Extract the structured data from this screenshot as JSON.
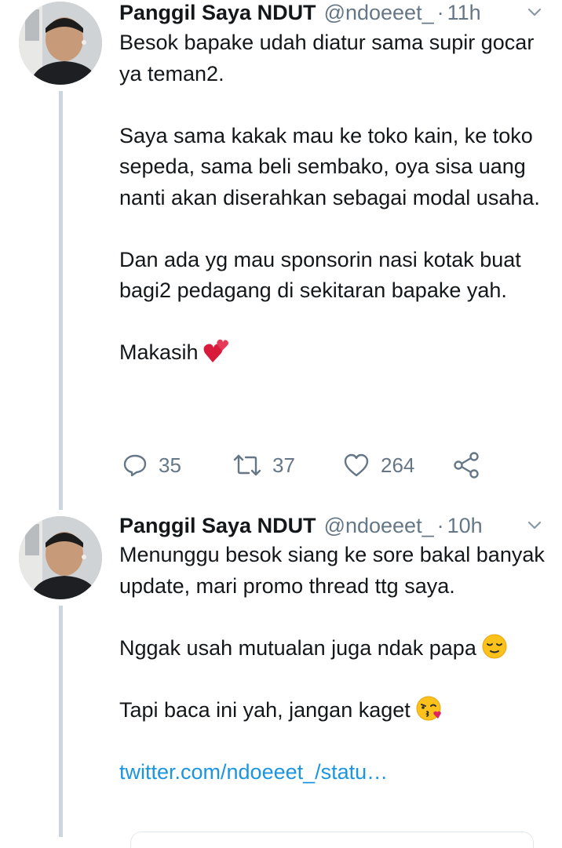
{
  "tweets": [
    {
      "author_name": "Panggil Saya NDUT",
      "handle": "@ndoeeet_",
      "separator": "·",
      "time": "11h",
      "paragraphs": [
        "Besok bapake udah diatur sama supir gocar ya teman2.",
        "Saya sama kakak mau ke toko kain, ke toko sepeda, sama beli sembako, oya sisa uang nanti akan diserahkan sebagai modal usaha.",
        "Dan ada yg mau sponsorin nasi kotak buat bagi2 pedagang di sekitaran bapake yah.",
        "Makasih"
      ],
      "emoji": "two-hearts-icon",
      "replies": "35",
      "retweets": "37",
      "likes": "264"
    },
    {
      "author_name": "Panggil Saya NDUT",
      "handle": "@ndoeeet_",
      "separator": "·",
      "time": "10h",
      "paragraphs": [
        "Menunggu besok siang ke sore bakal banyak update, mari promo thread ttg saya.",
        "Nggak usah mutualan juga ndak papa",
        "Tapi baca ini yah, jangan kaget"
      ],
      "emojis": [
        "relieved-face-icon",
        "kissing-face-heart-icon"
      ],
      "link": "twitter.com/ndoeeet_/statu…"
    }
  ],
  "colors": {
    "text": "#14171a",
    "secondary": "#657786",
    "link": "#1b95e0",
    "thread_line": "#ccd6dd",
    "heart": "#e0245e"
  }
}
